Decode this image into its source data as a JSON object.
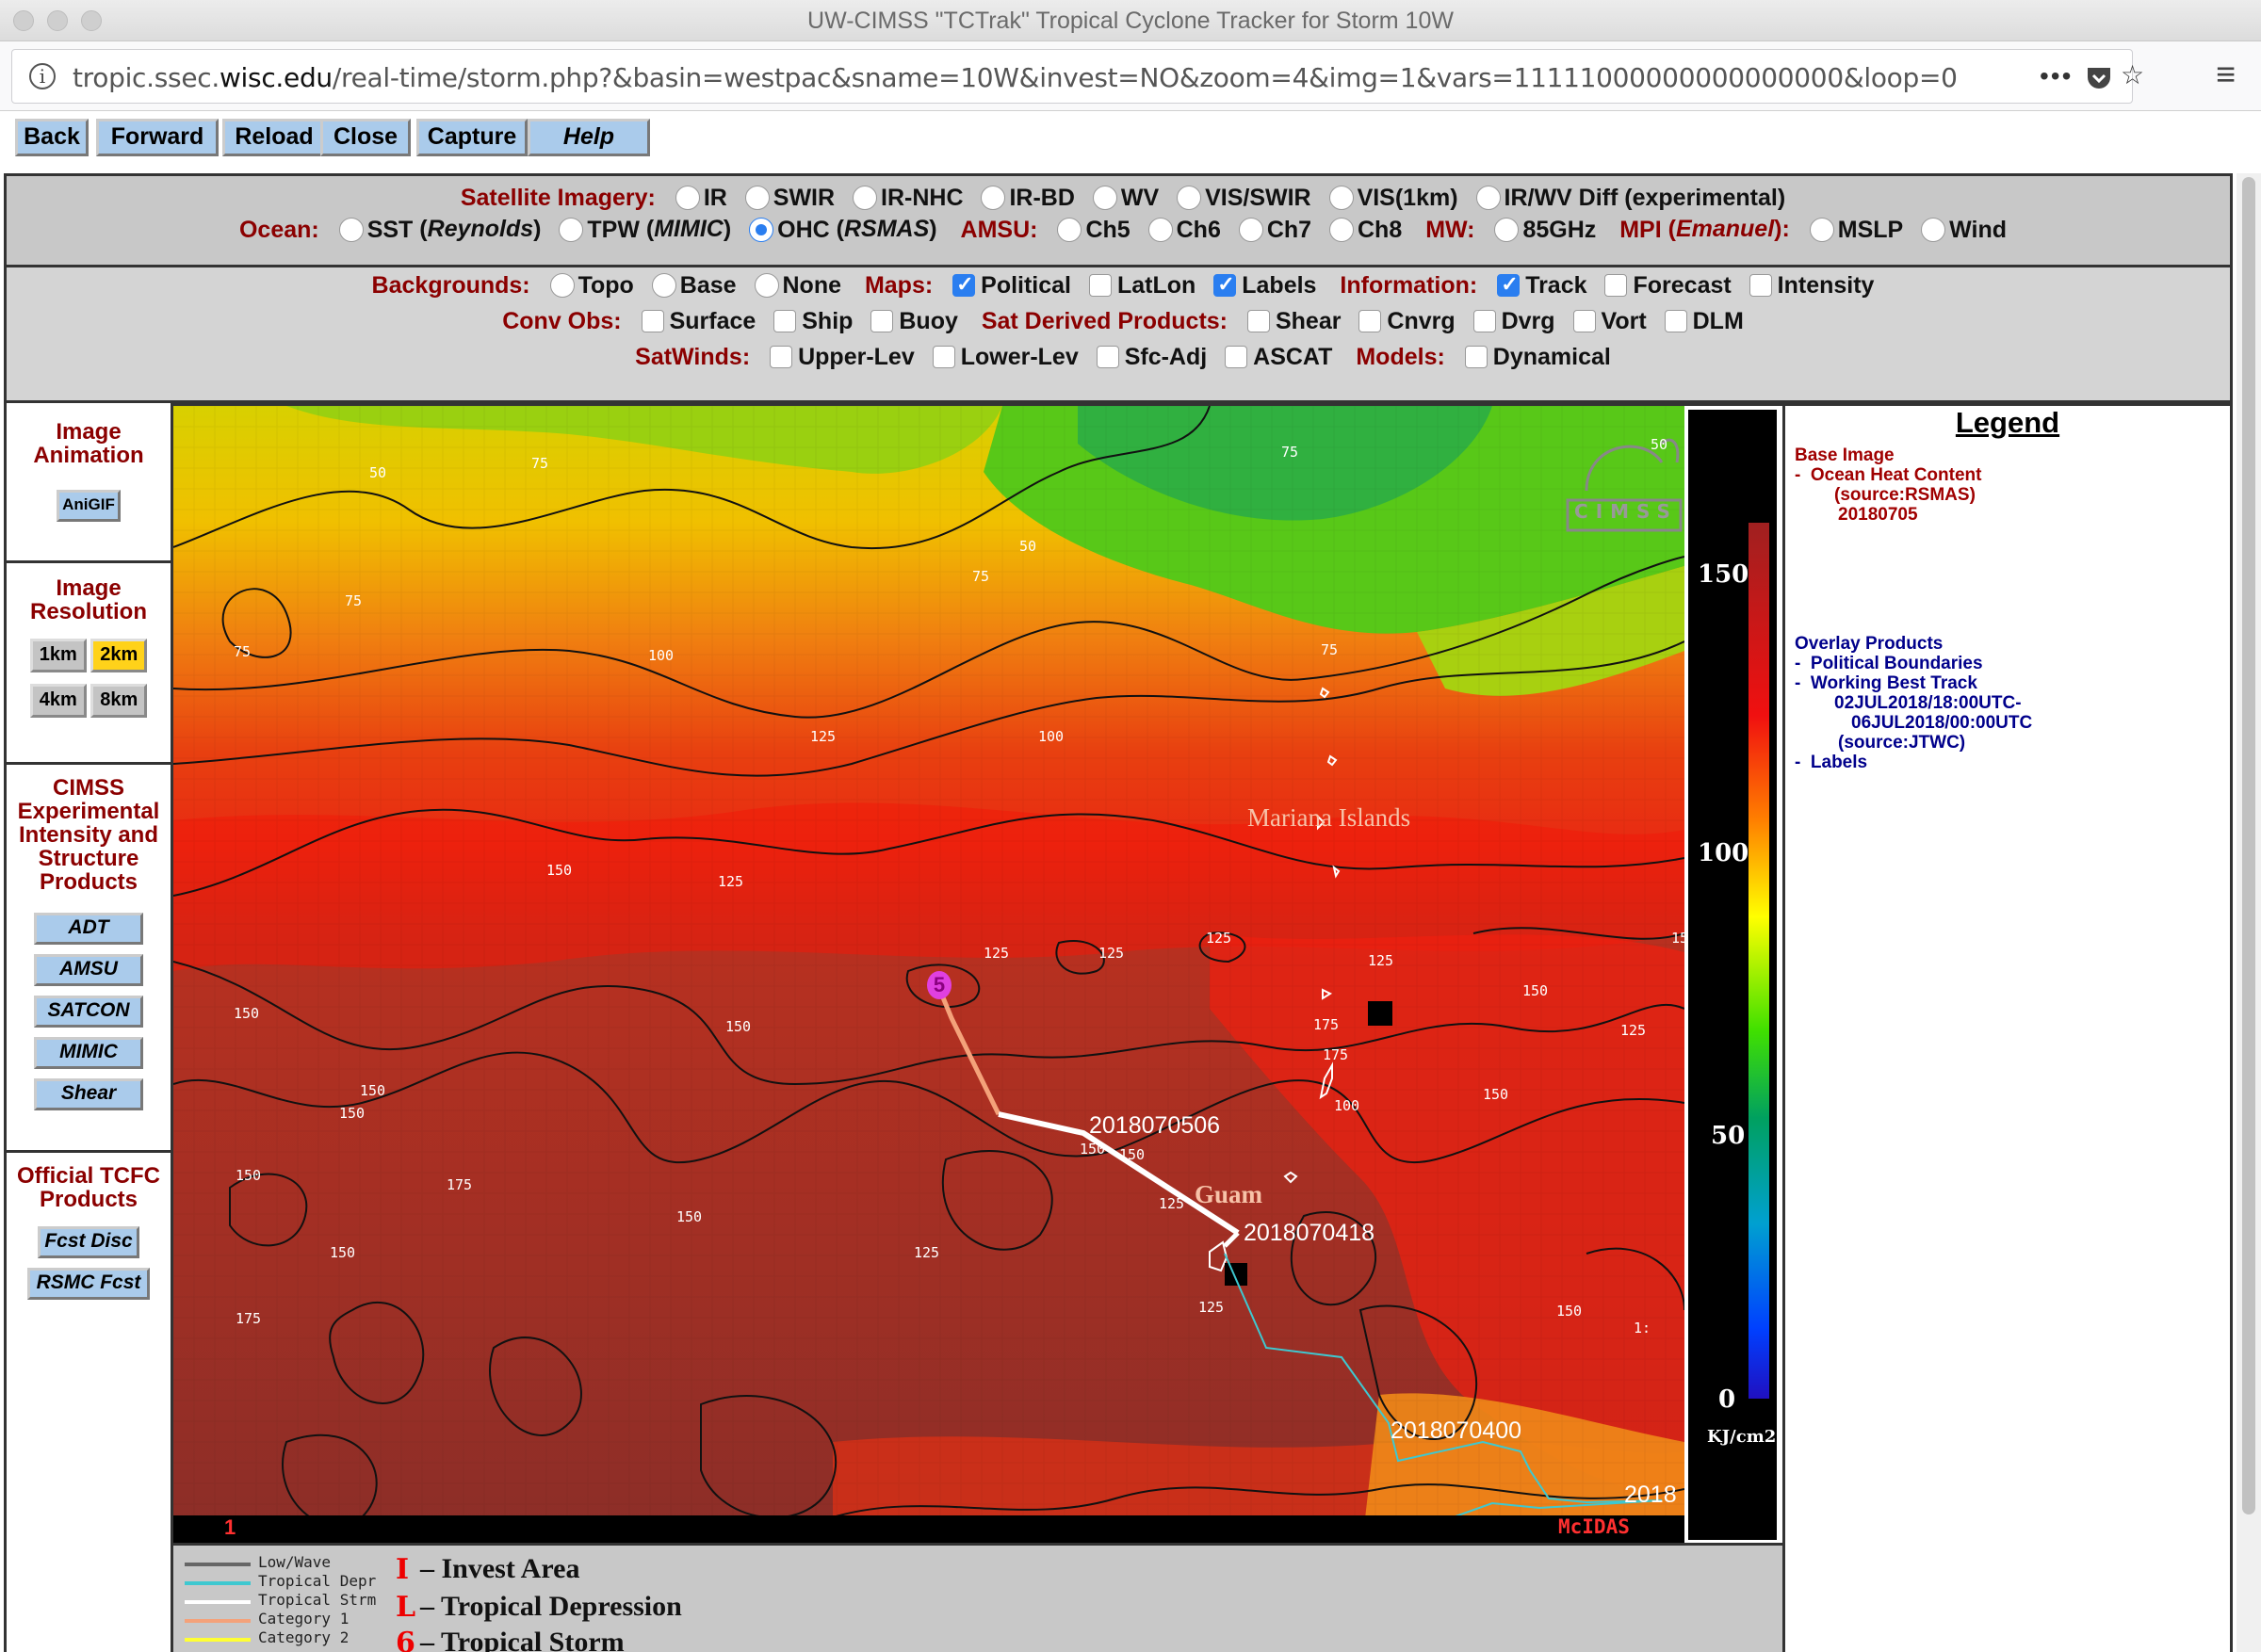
{
  "browser": {
    "window_title": "UW-CIMSS \"TCTrak\" Tropical Cyclone Tracker for Storm 10W",
    "url_prefix": "tropic.ssec.",
    "url_domain": "wisc.edu",
    "url_path": "/real-time/storm.php?&basin=westpac&sname=10W&invest=NO&zoom=4&img=1&vars=11111000000000000000&loop=0",
    "icons": [
      "info-icon",
      "more-icon",
      "pocket-icon",
      "bookmark-star-icon",
      "menu-icon"
    ]
  },
  "nav": {
    "buttons": [
      "Back",
      "Forward",
      "Reload",
      "Close",
      "Capture",
      "Help"
    ]
  },
  "controls": {
    "satellite_label": "Satellite Imagery:",
    "satellite_options": [
      "IR",
      "SWIR",
      "IR-NHC",
      "IR-BD",
      "WV",
      "VIS/SWIR",
      "VIS(1km)",
      "IR/WV Diff (experimental)"
    ],
    "ocean_label": "Ocean:",
    "ocean_options": [
      {
        "name": "SST",
        "paren": "Reynolds",
        "selected": false
      },
      {
        "name": "TPW",
        "paren": "MIMIC",
        "selected": false
      },
      {
        "name": "OHC",
        "paren": "RSMAS",
        "selected": true
      }
    ],
    "amsu_label": "AMSU:",
    "amsu_options": [
      "Ch5",
      "Ch6",
      "Ch7",
      "Ch8"
    ],
    "mw_label": "MW:",
    "mw_options": [
      "85GHz"
    ],
    "mpi_label": "MPI",
    "mpi_paren": "Emanuel",
    "mpi_options": [
      "MSLP",
      "Wind"
    ],
    "backgrounds_label": "Backgrounds:",
    "backgrounds_options": [
      "Topo",
      "Base",
      "None"
    ],
    "maps_label": "Maps:",
    "maps_options": [
      {
        "name": "Political",
        "checked": true
      },
      {
        "name": "LatLon",
        "checked": false
      },
      {
        "name": "Labels",
        "checked": true
      }
    ],
    "information_label": "Information:",
    "information_options": [
      {
        "name": "Track",
        "checked": true
      },
      {
        "name": "Forecast",
        "checked": false
      },
      {
        "name": "Intensity",
        "checked": false
      }
    ],
    "convobs_label": "Conv Obs:",
    "convobs_options": [
      "Surface",
      "Ship",
      "Buoy"
    ],
    "satderived_label": "Sat Derived Products:",
    "satderived_options": [
      "Shear",
      "Cnvrg",
      "Dvrg",
      "Vort",
      "DLM"
    ],
    "satwinds_label": "SatWinds:",
    "satwinds_options": [
      "Upper-Lev",
      "Lower-Lev",
      "Sfc-Adj",
      "ASCAT"
    ],
    "models_label": "Models:",
    "models_options": [
      "Dynamical"
    ]
  },
  "sidebar": {
    "animation_title": "Image Animation",
    "anigif": "AniGIF",
    "resolution_title": "Image Resolution",
    "resolutions": [
      {
        "label": "1km",
        "selected": false
      },
      {
        "label": "2km",
        "selected": true
      },
      {
        "label": "4km",
        "selected": false
      },
      {
        "label": "8km",
        "selected": false
      }
    ],
    "cimss_title": "CIMSS Experimental Intensity and Structure Products",
    "cimss_buttons": [
      "ADT",
      "AMSU",
      "SATCON",
      "MIMIC",
      "Shear"
    ],
    "official_title": "Official TCFC Products",
    "official_buttons": [
      "Fcst Disc",
      "RSMC Fcst"
    ]
  },
  "map": {
    "place_labels": [
      "Mariana Islands",
      "Guam"
    ],
    "track_labels": [
      "2018070506",
      "2018070418",
      "2018070400",
      "2018"
    ],
    "contour_labels": [
      "50",
      "75",
      "75",
      "50",
      "75",
      "75",
      "75",
      "100",
      "125",
      "100",
      "50",
      "75",
      "150",
      "125",
      "125",
      "125",
      "125",
      "125",
      "150",
      "150",
      "175",
      "150",
      "150",
      "150",
      "150",
      "150",
      "175",
      "150",
      "150",
      "150",
      "150",
      "175",
      "150",
      "125",
      "100",
      "125",
      "125",
      "150",
      "125",
      "175",
      "1:"
    ],
    "storm_symbol": "5",
    "frame_number": "1",
    "mcidas_tag": "McIDAS",
    "logo_text": "CIMSS"
  },
  "colorbar": {
    "ticks": [
      "150",
      "100",
      "50",
      "0"
    ],
    "unit": "KJ/cm2"
  },
  "legend": {
    "title": "Legend",
    "base_heading": "Base Image",
    "base_item": "Ocean Heat Content",
    "base_source": "(source:RSMAS)",
    "base_date": "20180705",
    "overlay_heading": "Overlay Products",
    "overlay_items": [
      "Political Boundaries",
      "Working Best Track"
    ],
    "track_start": "02JUL2018/18:00UTC-",
    "track_end": "06JUL2018/00:00UTC",
    "track_source": "(source:JTWC)",
    "labels_item": "Labels",
    "dash": "-"
  },
  "key": {
    "lines": [
      {
        "label": "Low/Wave",
        "color": "#666666"
      },
      {
        "label": "Tropical Depr",
        "color": "#3ec8d0"
      },
      {
        "label": "Tropical Strm",
        "color": "#ffffff"
      },
      {
        "label": "Category 1",
        "color": "#f4a27a"
      },
      {
        "label": "Category 2",
        "color": "#ffff33"
      }
    ],
    "symbols": [
      {
        "sym": "I",
        "text": "– Invest Area"
      },
      {
        "sym": "L",
        "text": "– Tropical Depression"
      },
      {
        "sym": "6",
        "text": "– Tropical Storm"
      }
    ]
  },
  "colors": {
    "accent_red": "#8b0000",
    "button_blue": "#aacbeb",
    "selected_yellow": "#ffd21a",
    "check_blue": "#2a7ef0"
  }
}
